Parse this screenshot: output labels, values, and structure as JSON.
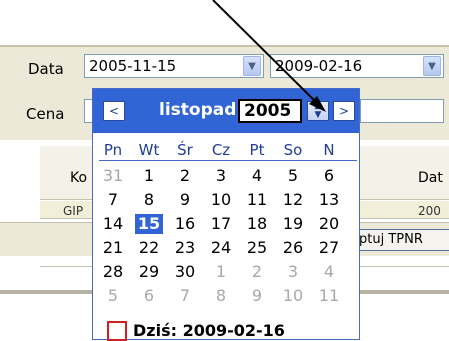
{
  "form": {
    "date_label": "Data",
    "price_label": "Cena",
    "date_from": "2005-11-15",
    "date_to": "2009-02-16",
    "dropdown_glyph": "▼"
  },
  "grid": {
    "columns": [
      "Ko",
      "Dat"
    ],
    "row_cells": [
      "GIP",
      "200"
    ]
  },
  "actions": {
    "accept_label": "ptuj TPNR"
  },
  "calendar": {
    "prev_glyph": "<",
    "next_glyph": ">",
    "month": "listopad",
    "year": "2005",
    "spin_glyph": "▲\n▼",
    "weekdays": [
      "Pn",
      "Wt",
      "Śr",
      "Cz",
      "Pt",
      "So",
      "N"
    ],
    "weeks": [
      [
        {
          "d": "31",
          "o": true
        },
        {
          "d": "1"
        },
        {
          "d": "2"
        },
        {
          "d": "3"
        },
        {
          "d": "4"
        },
        {
          "d": "5"
        },
        {
          "d": "6"
        }
      ],
      [
        {
          "d": "7"
        },
        {
          "d": "8"
        },
        {
          "d": "9"
        },
        {
          "d": "10"
        },
        {
          "d": "11"
        },
        {
          "d": "12"
        },
        {
          "d": "13"
        }
      ],
      [
        {
          "d": "14"
        },
        {
          "d": "15",
          "s": true
        },
        {
          "d": "16"
        },
        {
          "d": "17"
        },
        {
          "d": "18"
        },
        {
          "d": "19"
        },
        {
          "d": "20"
        }
      ],
      [
        {
          "d": "21"
        },
        {
          "d": "22"
        },
        {
          "d": "23"
        },
        {
          "d": "24"
        },
        {
          "d": "25"
        },
        {
          "d": "26"
        },
        {
          "d": "27"
        }
      ],
      [
        {
          "d": "28"
        },
        {
          "d": "29"
        },
        {
          "d": "30"
        },
        {
          "d": "1",
          "o": true
        },
        {
          "d": "2",
          "o": true
        },
        {
          "d": "3",
          "o": true
        },
        {
          "d": "4",
          "o": true
        }
      ],
      [
        {
          "d": "5",
          "o": true
        },
        {
          "d": "6",
          "o": true
        },
        {
          "d": "7",
          "o": true
        },
        {
          "d": "8",
          "o": true
        },
        {
          "d": "9",
          "o": true
        },
        {
          "d": "10",
          "o": true
        },
        {
          "d": "11",
          "o": true
        }
      ]
    ],
    "today_text": "Dziś: 2009-02-16"
  },
  "colors": {
    "header_blue": "#3165d6",
    "selected_day": "#3165d6",
    "today_marker": "#d02020"
  }
}
